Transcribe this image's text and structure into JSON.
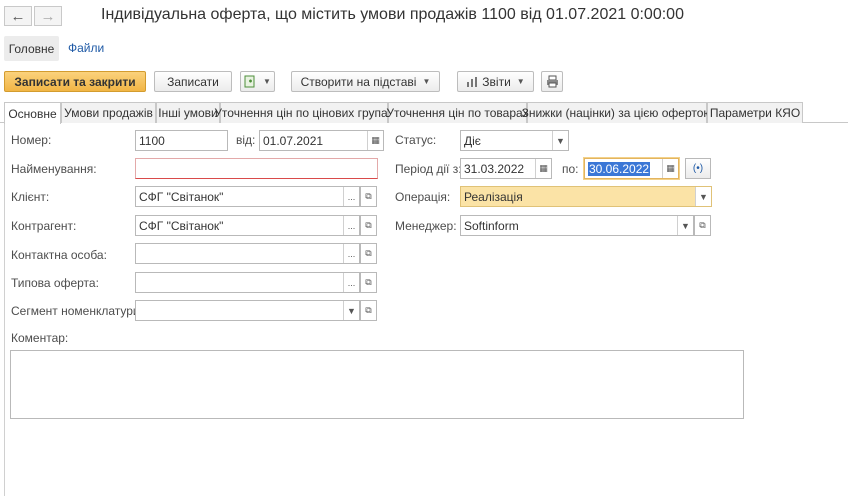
{
  "window": {
    "title": "Індивідуальна оферта, що містить умови продажів 1100 від 01.07.2021 0:00:00"
  },
  "sections": {
    "main": "Головне",
    "files": "Файли"
  },
  "toolbar": {
    "save_close": "Записати та закрити",
    "save": "Записати",
    "create_based": "Створити на підставі",
    "reports": "Звіти"
  },
  "tabs": [
    "Основне",
    "Умови продажів",
    "Інші умови",
    "Уточнення цін по цінових групах",
    "Уточнення цін по товарах",
    "Знижки (націнки) за цією офертою",
    "Параметри КЯО"
  ],
  "form": {
    "number_label": "Номер:",
    "number_value": "1100",
    "date_label": "від:",
    "date_value": "01.07.2021",
    "status_label": "Статус:",
    "status_value": "Діє",
    "name_label": "Найменування:",
    "name_value": "",
    "period_label": "Період дії з:",
    "period_from": "31.03.2022",
    "period_to_label": "по:",
    "period_to": "30.06.2022",
    "client_label": "Клієнт:",
    "client_value": "СФГ \"Світанок\"",
    "operation_label": "Операція:",
    "operation_value": "Реалізація",
    "contractor_label": "Контрагент:",
    "contractor_value": "СФГ \"Світанок\"",
    "manager_label": "Менеджер:",
    "manager_value": "Softinform",
    "contact_label": "Контактна особа:",
    "contact_value": "",
    "template_label": "Типова оферта:",
    "template_value": "",
    "segment_label": "Сегмент номенклатури:",
    "segment_value": "",
    "comment_label": "Коментар:",
    "comment_value": ""
  },
  "icons": {
    "back": "arrow-left-icon",
    "forward": "arrow-right-icon",
    "post": "document-post-icon",
    "print": "printer-icon",
    "calendar": "calendar-icon",
    "period": "period-select-icon",
    "open": "open-link-icon",
    "dropdown": "chevron-down-icon",
    "choose": "ellipsis-icon"
  },
  "colors": {
    "primary_button": "#f1b545",
    "selected_field": "#fbe3a6",
    "link": "#1f5aa6",
    "text_selection": "#3b77d6"
  }
}
